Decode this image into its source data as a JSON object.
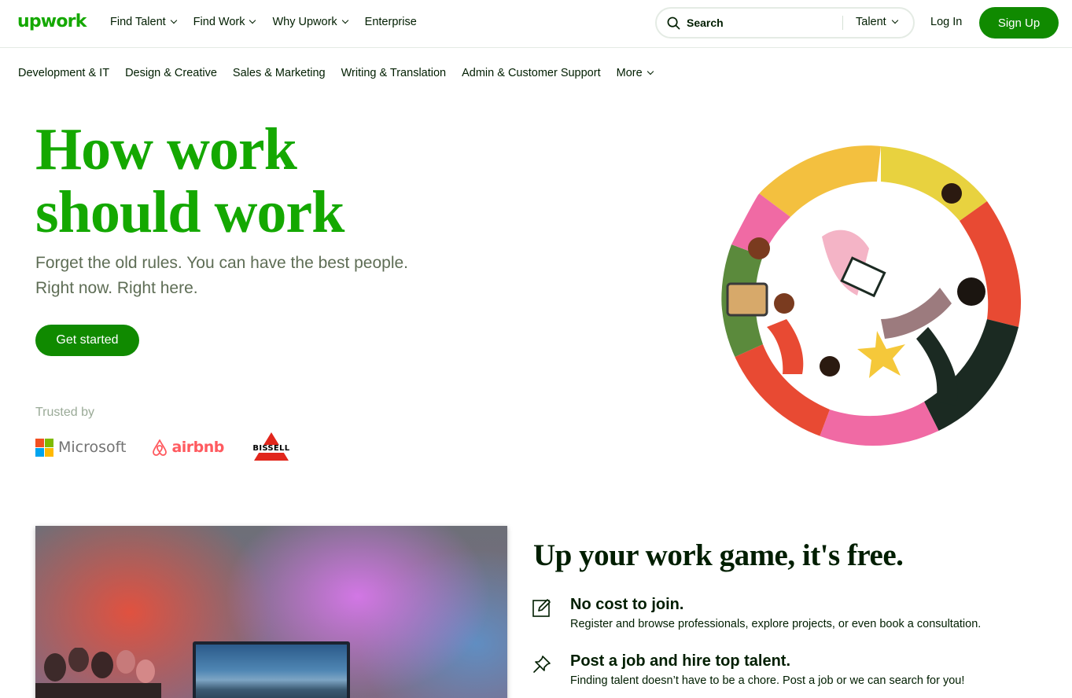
{
  "brand": {
    "logo_text": "upwork",
    "accent": "#14a800",
    "button_green": "#108a00"
  },
  "nav": {
    "items": [
      {
        "label": "Find Talent",
        "has_dropdown": true
      },
      {
        "label": "Find Work",
        "has_dropdown": true
      },
      {
        "label": "Why Upwork",
        "has_dropdown": true
      },
      {
        "label": "Enterprise",
        "has_dropdown": false
      }
    ],
    "search": {
      "placeholder": "Search",
      "category": "Talent"
    },
    "login_label": "Log In",
    "signup_label": "Sign Up"
  },
  "categories": [
    "Development & IT",
    "Design & Creative",
    "Sales & Marketing",
    "Writing & Translation",
    "Admin & Customer Support"
  ],
  "categories_more": "More",
  "hero": {
    "title_line1": "How work",
    "title_line2": "should work",
    "subtitle_line1": "Forget the old rules. You can have the best people.",
    "subtitle_line2": "Right now. Right here.",
    "cta_label": "Get started",
    "trusted_label": "Trusted by",
    "trusted_logos": [
      "Microsoft",
      "airbnb",
      "BISSELL"
    ]
  },
  "section": {
    "title": "Up your work game, it's free.",
    "features": [
      {
        "icon": "edit-icon",
        "title": "No cost to join.",
        "desc": "Register and browse professionals, explore projects, or even book a consultation."
      },
      {
        "icon": "pin-icon",
        "title": "Post a job and hire top talent.",
        "desc": "Finding talent doesn’t have to be a chore. Post a job or we can search for you!"
      }
    ]
  }
}
